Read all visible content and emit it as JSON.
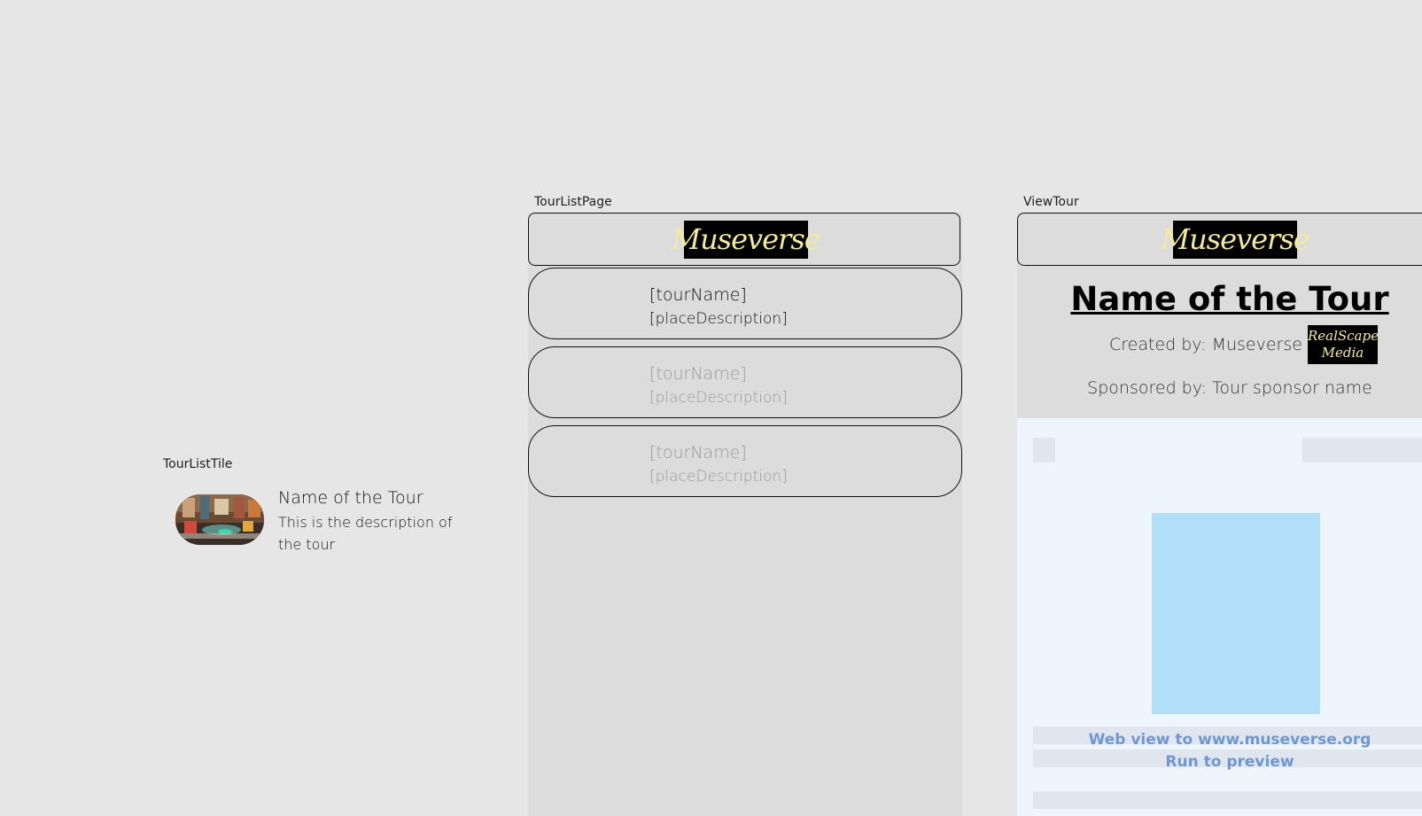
{
  "frames": {
    "tile_label": "TourListTile",
    "list_label": "TourListPage",
    "view_label": "ViewTour"
  },
  "tile": {
    "title": "Name of the Tour",
    "description": "This is the description of the tour",
    "thumbnail": "tour-photo-thumbnail"
  },
  "brand": {
    "logo_text": "Museverse",
    "logo_bg": "#000000",
    "logo_color": "#f4ea9a"
  },
  "tour_list": {
    "cards": [
      {
        "name": "[tourName]",
        "description": "[placeDescription]",
        "state": "primary"
      },
      {
        "name": "[tourName]",
        "description": "[placeDescription]",
        "state": "faded"
      },
      {
        "name": "[tourName]",
        "description": "[placeDescription]",
        "state": "faded"
      }
    ]
  },
  "view_tour": {
    "title": "Name of the Tour",
    "created_by": "Created by: Museverse",
    "sponsor_logo_line1": "RealScape",
    "sponsor_logo_line2": "Media",
    "sponsored_by": "Sponsored by: Tour sponsor name",
    "webview_line1": "Web view to www.museverse.org",
    "webview_line2": "Run to preview"
  },
  "colors": {
    "canvas": "#e6e6e6",
    "phone_bg": "#dcdcdc",
    "webview_bg": "#eef5fd",
    "webview_media": "#b1dff9",
    "webview_text": "#7096cf"
  }
}
